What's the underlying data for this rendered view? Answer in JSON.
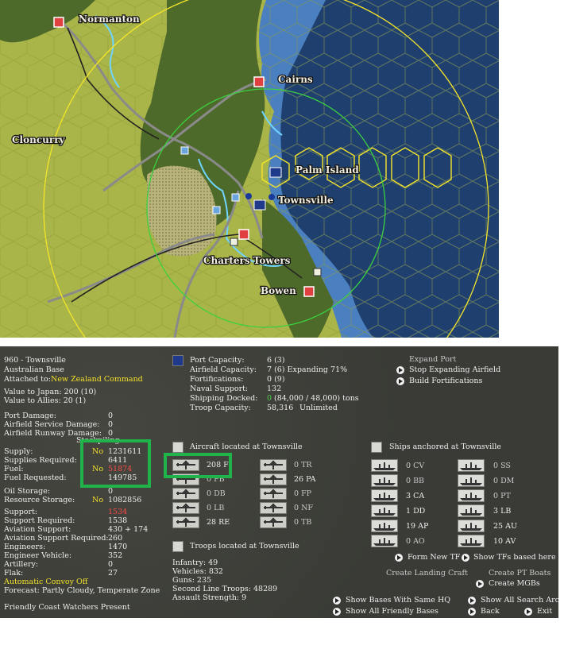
{
  "map": {
    "labels": {
      "normanton": "Normanton",
      "cairns": "Cairns",
      "cloncurry": "Cloncurry",
      "palm_island": "Palm Island",
      "townsville": "Townsville",
      "charters_towers": "Charters Towers",
      "bowen": "Bowen"
    }
  },
  "base": {
    "title": "960 - Townsville",
    "type": "Australian Base",
    "attached_label": "Attached to:",
    "attached_value": "New Zealand Command",
    "value_japan": "Value to Japan: 200 (10)",
    "value_allies": "Value to Allies: 20 (1)"
  },
  "damage": [
    {
      "label": "Port Damage:",
      "value": "0"
    },
    {
      "label": "Airfield Service Damage:",
      "value": "0"
    },
    {
      "label": "Airfield Runway Damage:",
      "value": "0"
    }
  ],
  "stockpiling_label": "Stockpiling",
  "supply": [
    {
      "label": "Supply:",
      "flag": "No",
      "value": "1231611"
    },
    {
      "label": "Supplies Required:",
      "flag": "",
      "value": "6411"
    },
    {
      "label": "Fuel:",
      "flag": "No",
      "value": "51874"
    },
    {
      "label": "Fuel Requested:",
      "flag": "",
      "value": "149785"
    }
  ],
  "storage": [
    {
      "label": "Oil Storage:",
      "flag": "",
      "value": "0"
    },
    {
      "label": "Resource Storage:",
      "flag": "No",
      "value": "1082856"
    }
  ],
  "support": [
    {
      "label": "Support:",
      "value": "1534"
    },
    {
      "label": "Support Required:",
      "value": "1538"
    },
    {
      "label": "Aviation Support:",
      "value": "430 + 174"
    },
    {
      "label": "Aviation Support Required:",
      "value": "260"
    },
    {
      "label": "Engineers:",
      "value": "1470"
    },
    {
      "label": "Engineer Vehicle:",
      "value": "352"
    },
    {
      "label": "Artillery:",
      "value": "0"
    },
    {
      "label": "Flak:",
      "value": "27"
    }
  ],
  "convoy": "Automatic Convoy Off",
  "forecast": "Forecast: Partly Cloudy, Temperate Zone",
  "coast_watchers": "Friendly Coast Watchers Present",
  "port": {
    "rows": [
      {
        "label": "Port Capacity:",
        "value": "6 (3)"
      },
      {
        "label": "Airfield Capacity:",
        "value": "7 (6) Expanding 71%"
      },
      {
        "label": "Fortifications:",
        "value": "0 (9)"
      },
      {
        "label": "Naval Support:",
        "value": "132"
      },
      {
        "label": "Shipping Docked:",
        "value_green": "0",
        "value": "(84,000 / 48,000) tons"
      },
      {
        "label": "Troop Capacity:",
        "value": "58,316",
        "extra": "Unlimited"
      }
    ]
  },
  "actions": {
    "expand_port": "Expand Port",
    "stop_expanding": "Stop Expanding Airfield",
    "build_fortifications": "Build Fortifications"
  },
  "aircraft": {
    "header": "Aircraft located at Townsville",
    "left": [
      "208 F",
      "0 FB",
      "0 DB",
      "0 LB",
      "28 RE"
    ],
    "right": [
      "0 TR",
      "26 PA",
      "0 FP",
      "0 NF",
      "0 TB"
    ]
  },
  "troops": {
    "header": "Troops located at Townsville",
    "lines": [
      "Infantry: 49",
      "Vehicles: 832",
      "Guns: 235",
      "Second Line Troops: 48289",
      "Assault Strength: 9"
    ]
  },
  "ships": {
    "header": "Ships anchored at Townsville",
    "left": [
      "0 CV",
      "0 BB",
      "3 CA",
      "1 DD",
      "19 AP",
      "0 AO"
    ],
    "right": [
      "0 SS",
      "0 DM",
      "0 PT",
      "3 LB",
      "25 AU",
      "10 AV"
    ],
    "form_new_tf": "Form New TF",
    "show_tfs": "Show TFs based here",
    "create_landing_craft": "Create Landing Craft",
    "create_pt_boats": "Create PT Boats",
    "create_mgbs": "Create MGBs"
  },
  "bottom": {
    "show_same_hq": "Show Bases With Same HQ",
    "show_search_arcs": "Show All Search Arcs",
    "show_friendly": "Show All Friendly Bases",
    "back": "Back",
    "exit": "Exit"
  },
  "colors": {
    "land": "#a9b548",
    "jungle": "#4e6a2a",
    "shallow_water": "#4b80c0",
    "deep_water": "#1f3f6e",
    "highlight": "#1fb34a",
    "panel": "#3a3b36",
    "yellow_text": "#f3e12a",
    "red_text": "#ff4a4a"
  }
}
